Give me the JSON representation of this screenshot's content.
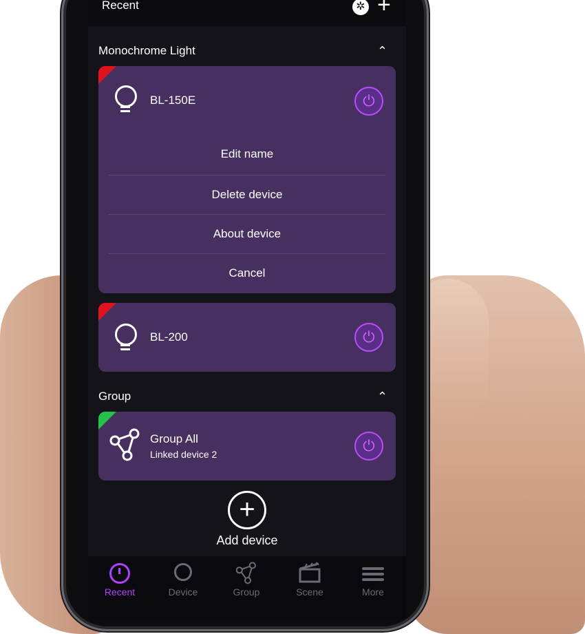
{
  "topbar": {
    "title": "Recent",
    "bluetooth_icon": "bluetooth-icon",
    "add_icon": "plus-icon"
  },
  "sections": {
    "monochrome": {
      "title": "Monochrome Light",
      "device1": {
        "name": "BL-150E",
        "status_color": "#e0141e"
      },
      "menu": {
        "edit": "Edit name",
        "delete": "Delete device",
        "about": "About device",
        "cancel": "Cancel"
      },
      "device2": {
        "name": "BL-200",
        "status_color": "#e0141e"
      }
    },
    "group": {
      "title": "Group",
      "item": {
        "name": "Group All",
        "subtitle": "Linked device  2",
        "status_color": "#23c04a"
      }
    }
  },
  "add_device": {
    "label": "Add device"
  },
  "bottom_nav": [
    {
      "label": "Recent",
      "icon": "clock-icon",
      "active": true
    },
    {
      "label": "Device",
      "icon": "bulb-icon",
      "active": false
    },
    {
      "label": "Group",
      "icon": "group-icon",
      "active": false
    },
    {
      "label": "Scene",
      "icon": "clapperboard-icon",
      "active": false
    },
    {
      "label": "More",
      "icon": "list-icon",
      "active": false
    }
  ],
  "colors": {
    "accent": "#b040ff",
    "card": "#47305f",
    "background": "#14131a"
  }
}
